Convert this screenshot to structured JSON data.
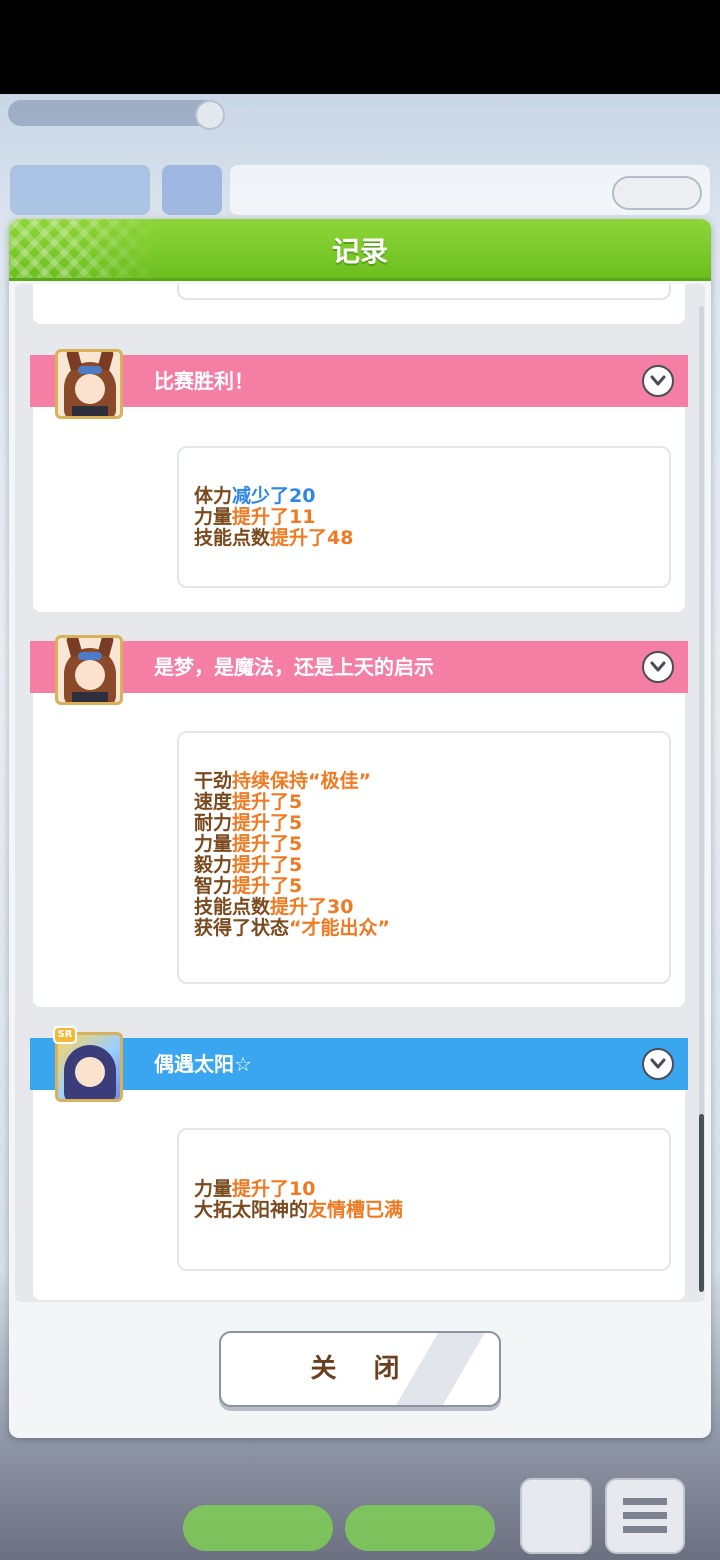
{
  "modal": {
    "title": "记录",
    "close_label": "关 闭"
  },
  "colors": {
    "header_green": "#7ac62b",
    "pink_header": "#f47ea4",
    "blue_header": "#3aa6ef",
    "brown_text": "#7a4a1f",
    "orange_text": "#f07a22",
    "blue_text": "#2f86e8"
  },
  "events": [
    {
      "title": "比赛胜利！",
      "theme": "pink",
      "icon": "horse-girl-avatar",
      "lines": [
        {
          "prefix": "体力",
          "suffix": "减少了20",
          "suffix_color": "blue"
        },
        {
          "prefix": "力量",
          "suffix": "提升了11",
          "suffix_color": "orange"
        },
        {
          "prefix": "技能点数",
          "suffix": "提升了48",
          "suffix_color": "orange"
        }
      ]
    },
    {
      "title": "是梦，是魔法，还是上天的启示",
      "theme": "pink",
      "icon": "horse-girl-avatar",
      "lines": [
        {
          "prefix": "干劲",
          "suffix": "持续保持“极佳”",
          "suffix_color": "orange"
        },
        {
          "prefix": "速度",
          "suffix": "提升了5",
          "suffix_color": "orange"
        },
        {
          "prefix": "耐力",
          "suffix": "提升了5",
          "suffix_color": "orange"
        },
        {
          "prefix": "力量",
          "suffix": "提升了5",
          "suffix_color": "orange"
        },
        {
          "prefix": "毅力",
          "suffix": "提升了5",
          "suffix_color": "orange"
        },
        {
          "prefix": "智力",
          "suffix": "提升了5",
          "suffix_color": "orange"
        },
        {
          "prefix": "技能点数",
          "suffix": "提升了30",
          "suffix_color": "orange"
        },
        {
          "prefix": "获得了状态",
          "suffix": "“才能出众”",
          "suffix_color": "orange"
        }
      ]
    },
    {
      "title": "偶遇太阳☆",
      "theme": "blue",
      "icon": "support-card-avatar",
      "badge": "SR",
      "lines": [
        {
          "prefix": "力量",
          "suffix": "提升了10",
          "suffix_color": "orange"
        },
        {
          "prefix": "大拓太阳神的",
          "suffix": "友情槽已满",
          "suffix_color": "orange"
        }
      ]
    }
  ]
}
